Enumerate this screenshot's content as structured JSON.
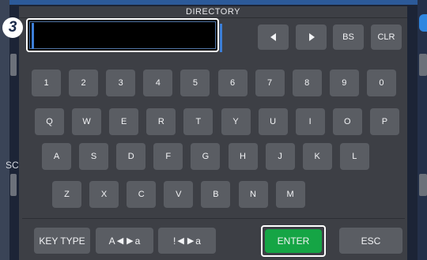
{
  "dialog": {
    "title": "DIRECTORY",
    "step_badge": "3",
    "input_value": ""
  },
  "nav_keys": {
    "left_icon": "triangle-left-icon",
    "right_icon": "triangle-right-icon",
    "bs": "BS",
    "clr": "CLR"
  },
  "rows": {
    "digits": [
      "1",
      "2",
      "3",
      "4",
      "5",
      "6",
      "7",
      "8",
      "9",
      "0"
    ],
    "row_q": [
      "Q",
      "W",
      "E",
      "R",
      "T",
      "Y",
      "U",
      "I",
      "O",
      "P"
    ],
    "row_a": [
      "A",
      "S",
      "D",
      "F",
      "G",
      "H",
      "J",
      "K",
      "L"
    ],
    "row_z": [
      "Z",
      "X",
      "C",
      "V",
      "B",
      "N",
      "M"
    ]
  },
  "bottom": {
    "key_type": "KEY TYPE",
    "mode_upper_prefix": "A",
    "mode_upper_suffix": "a",
    "mode_symbol_prefix": "!",
    "mode_symbol_suffix": "a",
    "enter": "ENTER",
    "esc": "ESC"
  },
  "background": {
    "left_label": "SC"
  },
  "colors": {
    "panel": "#3d3f45",
    "key": "#5a5d63",
    "enter": "#15a545",
    "cursor": "#3d7fd8"
  }
}
